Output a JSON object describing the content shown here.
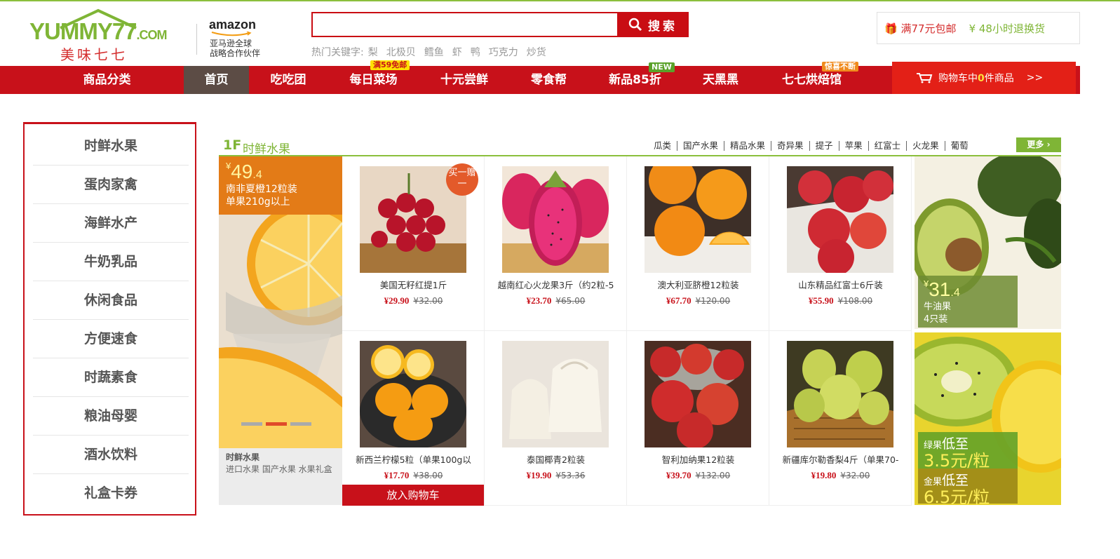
{
  "header": {
    "logo_text": "YUMMY77",
    "logo_com": ".COM",
    "logo_cn": "美味七七",
    "partner_name": "amazon",
    "partner_line1": "亚马逊全球",
    "partner_line2": "战略合作伙伴",
    "search_placeholder": "",
    "search_button": "搜索",
    "hot_label": "热门关键字:",
    "hot_keywords": [
      "梨",
      "北极贝",
      "鳕鱼",
      "虾",
      "鸭",
      "巧克力",
      "炒货"
    ],
    "promo_free_shipping": "满77元包邮",
    "promo_return": "48小时退换货"
  },
  "nav": {
    "items": [
      {
        "label": "商品分类"
      },
      {
        "label": "首页"
      },
      {
        "label": "吃吃团"
      },
      {
        "label": "每日菜场",
        "badge": "满59免邮"
      },
      {
        "label": "十元尝鲜"
      },
      {
        "label": "零食帮"
      },
      {
        "label": "新品85折",
        "badge": "NEW"
      },
      {
        "label": "天黑黑"
      },
      {
        "label": "七七烘焙馆",
        "badge": "惊喜不断"
      }
    ],
    "cart_prefix": "购物车中",
    "cart_count": "0",
    "cart_suffix": "件商品",
    "cart_arrow": ">>"
  },
  "sidebar": {
    "items": [
      "时鲜水果",
      "蛋肉家禽",
      "海鲜水产",
      "牛奶乳品",
      "休闲食品",
      "方便速食",
      "时蔬素食",
      "粮油母婴",
      "酒水饮料",
      "礼盒卡券"
    ]
  },
  "floor": {
    "number": "1F",
    "name": "时鲜水果",
    "links": [
      "瓜类",
      "国产水果",
      "精品水果",
      "奇异果",
      "提子",
      "苹果",
      "红富士",
      "火龙果",
      "葡萄"
    ],
    "more": "更多"
  },
  "left_banner": {
    "currency": "¥",
    "price_int": "49",
    "price_dec": ".4",
    "line1": "南非夏橙12粒装",
    "line2": "单果210g以上",
    "bottom_title": "时鲜水果",
    "bottom_links": "进口水果 国产水果 水果礼盒"
  },
  "products": [
    {
      "name": "美国无籽红提1斤",
      "price": "¥29.90",
      "old": "¥32.00",
      "sticker": "买一赠一"
    },
    {
      "name": "越南红心火龙果3斤（约2粒-5",
      "price": "¥23.70",
      "old": "¥65.00"
    },
    {
      "name": "澳大利亚脐橙12粒装",
      "price": "¥67.70",
      "old": "¥120.00"
    },
    {
      "name": "山东精品红富士6斤装",
      "price": "¥55.90",
      "old": "¥108.00"
    },
    {
      "name": "新西兰柠檬5粒（单果100g以",
      "price": "¥17.70",
      "old": "¥38.00"
    },
    {
      "name": "泰国椰青2粒装",
      "price": "¥19.90",
      "old": "¥53.36"
    },
    {
      "name": "智利加纳果12粒装",
      "price": "¥39.70",
      "old": "¥132.00"
    },
    {
      "name": "新疆库尔勒香梨4斤（单果70-",
      "price": "¥19.80",
      "old": "¥32.00"
    }
  ],
  "add_to_cart": "放入购物车",
  "right_banner_top": {
    "currency": "¥",
    "price_int": "31",
    "price_dec": ".4",
    "line1": "牛油果",
    "line2": "4只装"
  },
  "right_banner_bottom": {
    "g_label": "绿果",
    "g_text": "低至",
    "g_price": "3.5元/粒",
    "y_label": "金果",
    "y_text": "低至",
    "y_price": "6.5元/粒"
  },
  "colors": {
    "brand_red": "#c8111a",
    "brand_green": "#7fb536",
    "nav_active": "#5c4c45",
    "orange": "#e37b17"
  }
}
